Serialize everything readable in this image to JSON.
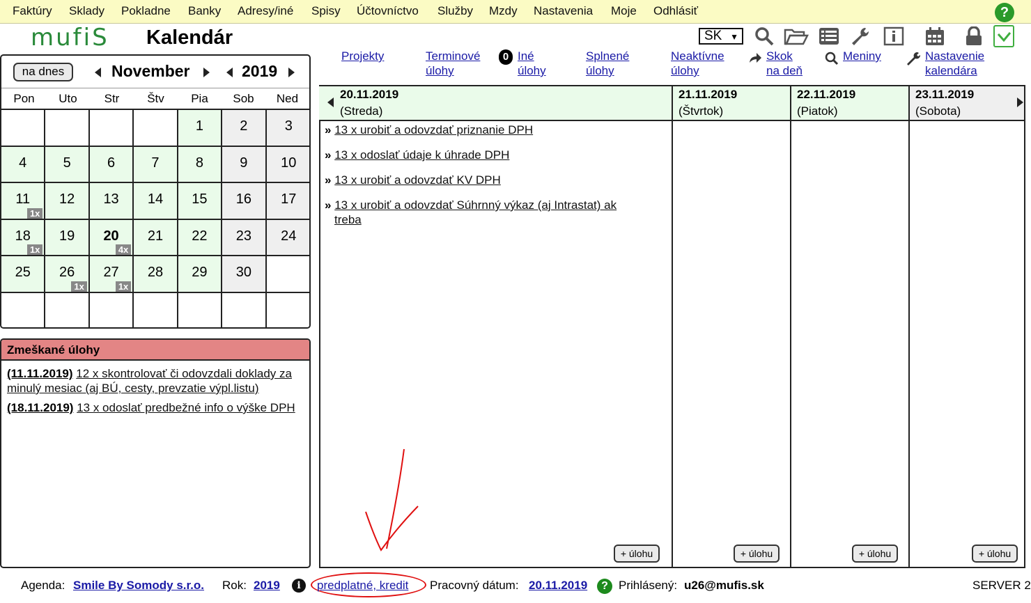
{
  "menu": [
    "Faktúry",
    "Sklady",
    "Pokladne",
    "Banky",
    "Adresy/iné",
    "Spisy",
    "Účtovníctvo",
    "Služby",
    "Mzdy",
    "Nastavenia",
    "Moje",
    "Odhlásiť"
  ],
  "help_symbol": "?",
  "logo_text": "mufiS",
  "page_title": "Kalendár",
  "lang": "SK",
  "lang_arrow": "▼",
  "nav": {
    "projekty": "Projekty",
    "terminove": [
      "Terminové",
      "úlohy"
    ],
    "ine_count": "0",
    "ine": [
      "Iné",
      "úlohy"
    ],
    "splnene": [
      "Splnené",
      "úlohy"
    ],
    "neaktivne": [
      "Neaktívne",
      "úlohy"
    ],
    "skok": [
      "Skok",
      "na deň"
    ],
    "meniny": "Meniny",
    "nastavenie": [
      "Nastavenie",
      "kalendára"
    ]
  },
  "mini_cal": {
    "today_btn": "na dnes",
    "month": "November",
    "year": "2019",
    "weekdays": [
      "Pon",
      "Uto",
      "Str",
      "Štv",
      "Pia",
      "Sob",
      "Ned"
    ],
    "cells": [
      {
        "d": "",
        "t": "e"
      },
      {
        "d": "",
        "t": "e"
      },
      {
        "d": "",
        "t": "e"
      },
      {
        "d": "",
        "t": "e"
      },
      {
        "d": "1",
        "t": "wk"
      },
      {
        "d": "2",
        "t": "we"
      },
      {
        "d": "3",
        "t": "we"
      },
      {
        "d": "4",
        "t": "wk"
      },
      {
        "d": "5",
        "t": "wk"
      },
      {
        "d": "6",
        "t": "wk"
      },
      {
        "d": "7",
        "t": "wk"
      },
      {
        "d": "8",
        "t": "wk"
      },
      {
        "d": "9",
        "t": "we"
      },
      {
        "d": "10",
        "t": "we"
      },
      {
        "d": "11",
        "t": "wk",
        "c": "1x"
      },
      {
        "d": "12",
        "t": "wk"
      },
      {
        "d": "13",
        "t": "wk"
      },
      {
        "d": "14",
        "t": "wk"
      },
      {
        "d": "15",
        "t": "wk"
      },
      {
        "d": "16",
        "t": "we"
      },
      {
        "d": "17",
        "t": "we"
      },
      {
        "d": "18",
        "t": "wk",
        "c": "1x"
      },
      {
        "d": "19",
        "t": "wk"
      },
      {
        "d": "20",
        "t": "wk",
        "c": "4x",
        "today": true
      },
      {
        "d": "21",
        "t": "wk"
      },
      {
        "d": "22",
        "t": "wk"
      },
      {
        "d": "23",
        "t": "we"
      },
      {
        "d": "24",
        "t": "we"
      },
      {
        "d": "25",
        "t": "wk"
      },
      {
        "d": "26",
        "t": "wk",
        "c": "1x"
      },
      {
        "d": "27",
        "t": "wk",
        "c": "1x"
      },
      {
        "d": "28",
        "t": "wk"
      },
      {
        "d": "29",
        "t": "wk"
      },
      {
        "d": "30",
        "t": "we"
      },
      {
        "d": "",
        "t": "e"
      },
      {
        "d": "",
        "t": "e"
      },
      {
        "d": "",
        "t": "e"
      },
      {
        "d": "",
        "t": "e"
      },
      {
        "d": "",
        "t": "e"
      },
      {
        "d": "",
        "t": "e"
      },
      {
        "d": "",
        "t": "e"
      },
      {
        "d": "",
        "t": "e"
      }
    ]
  },
  "missed": {
    "title": "Zmeškané úlohy",
    "items": [
      {
        "date": "(11.11.2019)",
        "text": "12 x skontrolovať či odovzdali doklady za minulý mesiac (aj BÚ, cesty, prevzatie výpl.listu)"
      },
      {
        "date": "(18.11.2019)",
        "text": "13 x odoslať predbežné info o výške DPH"
      }
    ]
  },
  "week": {
    "days": [
      {
        "date": "20.11.2019",
        "name": "(Streda)"
      },
      {
        "date": "21.11.2019",
        "name": "(Štvrtok)"
      },
      {
        "date": "22.11.2019",
        "name": "(Piatok)"
      },
      {
        "date": "23.11.2019",
        "name": "(Sobota)"
      }
    ],
    "bullet": "»",
    "tasks": [
      "13 x urobiť a odovzdať priznanie DPH",
      "13 x odoslať údaje k úhrade DPH",
      "13 x urobiť a odovzdať KV DPH",
      "13 x urobiť a odovzdať Súhrnný výkaz (aj Intrastat) ak treba"
    ],
    "add_label": "+ úlohu"
  },
  "footer": {
    "agenda_label": "Agenda:",
    "agenda_value": "Smile By Somody s.r.o.",
    "rok_label": "Rok:",
    "rok_value": "2019",
    "info_symbol": "i",
    "credit": "predplatné, kredit",
    "datum_label": "Pracovný dátum:",
    "datum_value": "20.11.2019",
    "help_symbol": "?",
    "user_label": "Prihlásený:",
    "user_value": "u26@mufis.sk",
    "server": "SERVER 2"
  },
  "colors": {
    "menu_bg": "#fbfbc4",
    "weekday_bg": "#eafbea",
    "weekend_bg": "#efefef",
    "missed_header": "#e38585",
    "link": "#1a1aa6",
    "logo": "#2a8a3a",
    "annotation": "#e01010"
  }
}
